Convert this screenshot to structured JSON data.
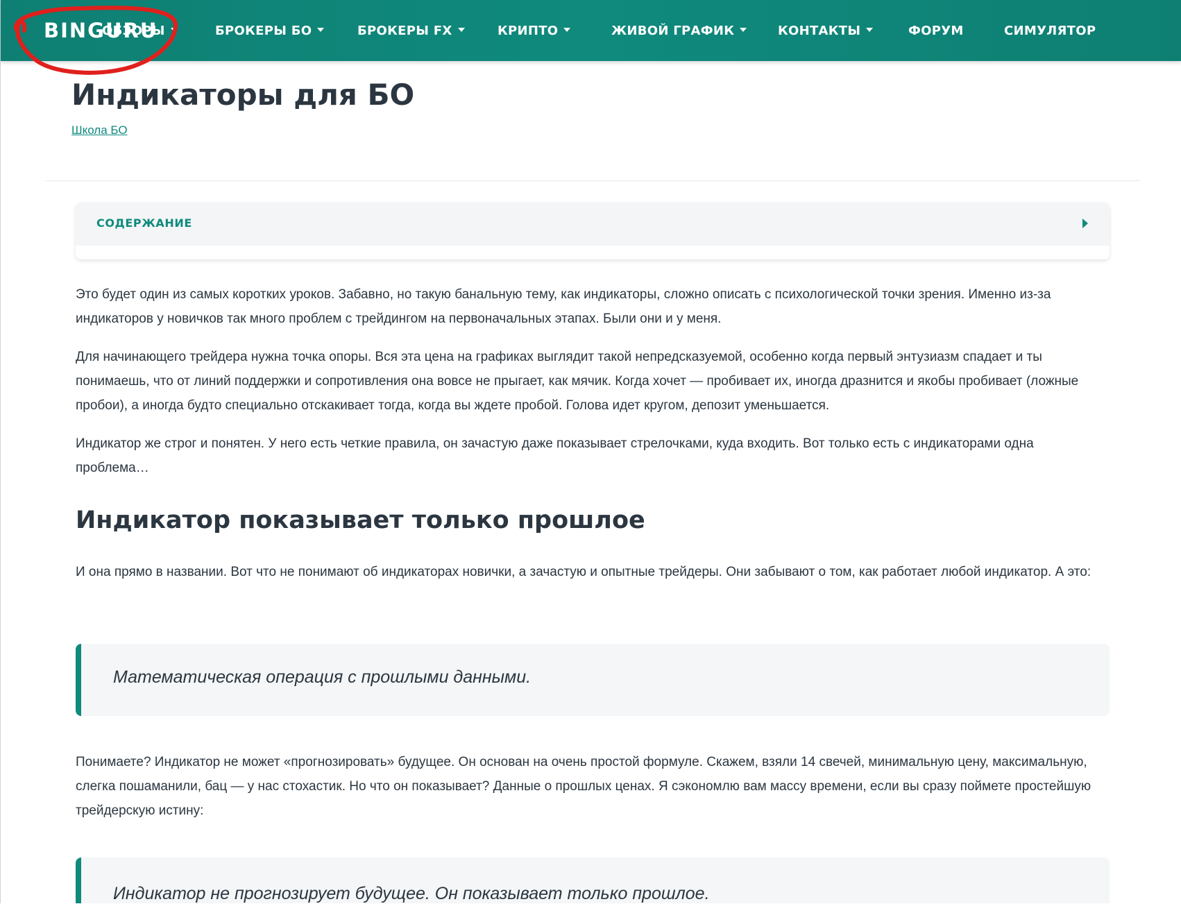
{
  "header": {
    "logo": "BINGURU",
    "nav": [
      {
        "label": "ОБЗОРЫ",
        "has_dropdown": true
      },
      {
        "label": "БРОКЕРЫ БО",
        "has_dropdown": true
      },
      {
        "label": "БРОКЕРЫ FX",
        "has_dropdown": true
      },
      {
        "label": "КРИПТО",
        "has_dropdown": true
      },
      {
        "label": "ЖИВОЙ ГРАФИК",
        "has_dropdown": true
      },
      {
        "label": "КОНТАКТЫ",
        "has_dropdown": true
      },
      {
        "label": "ФОРУМ",
        "has_dropdown": false
      },
      {
        "label": "СИМУЛЯТОР",
        "has_dropdown": false
      }
    ]
  },
  "page": {
    "title": "Индикаторы для БО",
    "breadcrumb": "Школа БО"
  },
  "toc": {
    "title": "СОДЕРЖАНИЕ",
    "icon": "chevron-right-icon"
  },
  "article": {
    "paragraphs": [
      "Это будет один из самых коротких уроков. Забавно, но такую банальную тему, как индикаторы, сложно описать с психологической точки зрения. Именно из-за индикаторов у новичков так много проблем с трейдингом на первоначальных этапах. Были они и у меня.",
      "Для начинающего трейдера нужна точка опоры. Вся эта цена на графиках выглядит такой непредсказуемой, особенно когда первый энтузиазм спадает и ты понимаешь, что от линий поддержки и сопротивления она вовсе не прыгает, как мячик. Когда хочет — пробивает их, иногда дразнится и якобы пробивает (ложные пробои), а иногда будто специально отскакивает тогда, когда вы ждете пробой. Голова идет кругом, депозит уменьшается.",
      "Индикатор же строг и понятен. У него есть четкие правила, он зачастую даже показывает стрелочками, куда входить. Вот только есть с индикаторами одна проблема…"
    ],
    "heading": "Индикатор показывает только прошлое",
    "paragraph_after_heading": "И она прямо в названии. Вот что не понимают об индикаторах новички, а зачастую и опытные трейдеры. Они забывают о том, как работает любой индикатор. А это:",
    "quote1": "Математическая операция с прошлыми данными.",
    "paragraph_after_quote": "Понимаете? Индикатор не может «прогнозировать» будущее. Он основан на очень простой формуле. Скажем, взяли 14 свечей, минимальную цену, максимальную, слегка пошаманили, бац — у нас стохастик. Но что он показывает? Данные о прошлых ценах. Я сэкономлю вам массу времени, если вы сразу поймете простейшую трейдерскую истину:",
    "quote2": "Индикатор не прогнозирует будущее. Он показывает только прошлое."
  },
  "colors": {
    "brand_teal": "#0f8a7d",
    "annotation_red": "#e0201c"
  }
}
